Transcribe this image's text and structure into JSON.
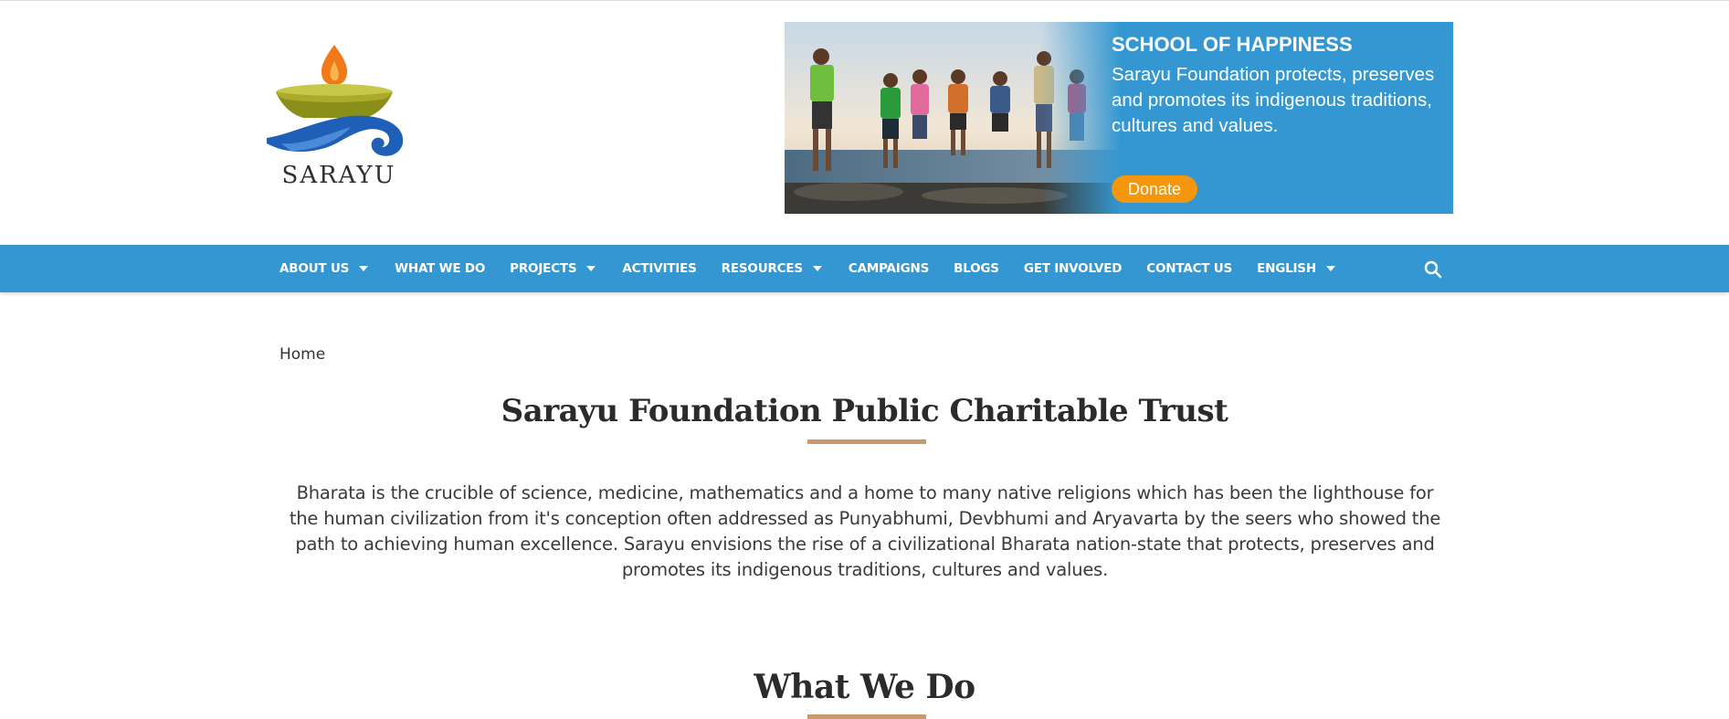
{
  "header": {
    "logo_text": "SARAYU"
  },
  "banner": {
    "title": "SCHOOL OF HAPPINESS",
    "text": "Sarayu Foundation protects, preserves and promotes its indigenous traditions, cultures and values.",
    "donate_label": "Donate",
    "colors": {
      "background": "#3497d1",
      "button": "#f4970d"
    }
  },
  "nav": {
    "items": [
      {
        "label": "ABOUT US",
        "dropdown": true
      },
      {
        "label": "WHAT WE DO",
        "dropdown": false
      },
      {
        "label": "PROJECTS",
        "dropdown": true
      },
      {
        "label": "ACTIVITIES",
        "dropdown": false
      },
      {
        "label": "RESOURCES",
        "dropdown": true
      },
      {
        "label": "CAMPAIGNS",
        "dropdown": false
      },
      {
        "label": "BLOGS",
        "dropdown": false
      },
      {
        "label": "GET INVOLVED",
        "dropdown": false
      },
      {
        "label": "CONTACT US",
        "dropdown": false
      },
      {
        "label": "ENGLISH",
        "dropdown": true
      }
    ],
    "search_icon": "search-icon",
    "color": "#3497d1"
  },
  "breadcrumb": {
    "home": "Home"
  },
  "main": {
    "title": "Sarayu Foundation Public Charitable Trust",
    "intro": "Bharata is the crucible of science, medicine, mathematics and a home to many native religions which has been the lighthouse for the human civilization from it's conception often addressed as Punyabhumi, Devbhumi and Aryavarta by the seers who showed the path to achieving human excellence. Sarayu envisions the rise of a civilizational Bharata nation-state that protects, preserves and promotes its indigenous traditions, cultures and values.",
    "section_title": "What We Do",
    "accent_color": "#c69a6d"
  }
}
